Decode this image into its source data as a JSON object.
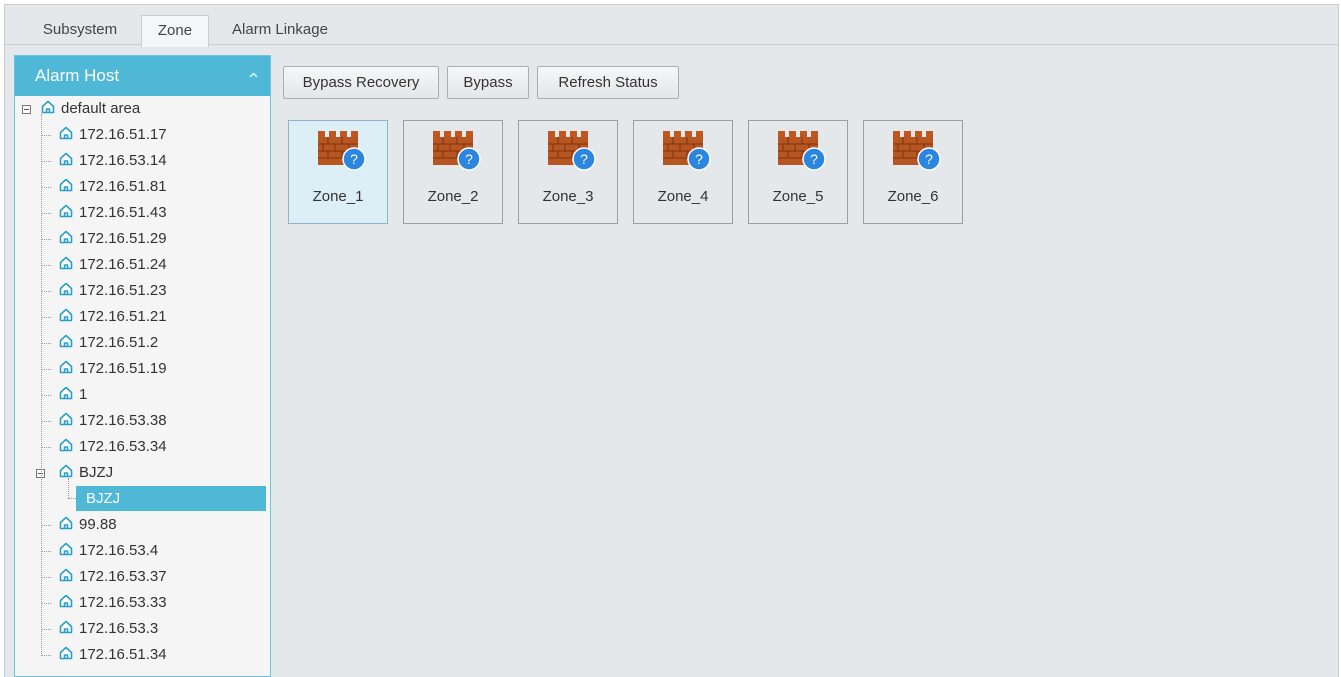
{
  "tabs": [
    {
      "label": "Subsystem"
    },
    {
      "label": "Zone"
    },
    {
      "label": "Alarm Linkage"
    }
  ],
  "sidebar": {
    "title": "Alarm Host",
    "root_label": "default area",
    "items": [
      "172.16.51.17",
      "172.16.53.14",
      "172.16.51.81",
      "172.16.51.43",
      "172.16.51.29",
      "172.16.51.24",
      "172.16.51.23",
      "172.16.51.21",
      "172.16.51.2",
      "172.16.51.19",
      "1",
      "172.16.53.38",
      "172.16.53.34"
    ],
    "group_label": "BJZJ",
    "selected_child": "BJZJ",
    "items_after": [
      "99.88",
      "172.16.53.4",
      "172.16.53.37",
      "172.16.53.33",
      "172.16.53.3",
      "172.16.51.34"
    ]
  },
  "toolbar": {
    "bypass_recovery": "Bypass Recovery",
    "bypass": "Bypass",
    "refresh_status": "Refresh Status"
  },
  "zones": [
    "Zone_1",
    "Zone_2",
    "Zone_3",
    "Zone_4",
    "Zone_5",
    "Zone_6"
  ],
  "colors": {
    "accent": "#4fb8d6",
    "background": "#e4e8ea",
    "selected_zone": "#dceef6"
  }
}
